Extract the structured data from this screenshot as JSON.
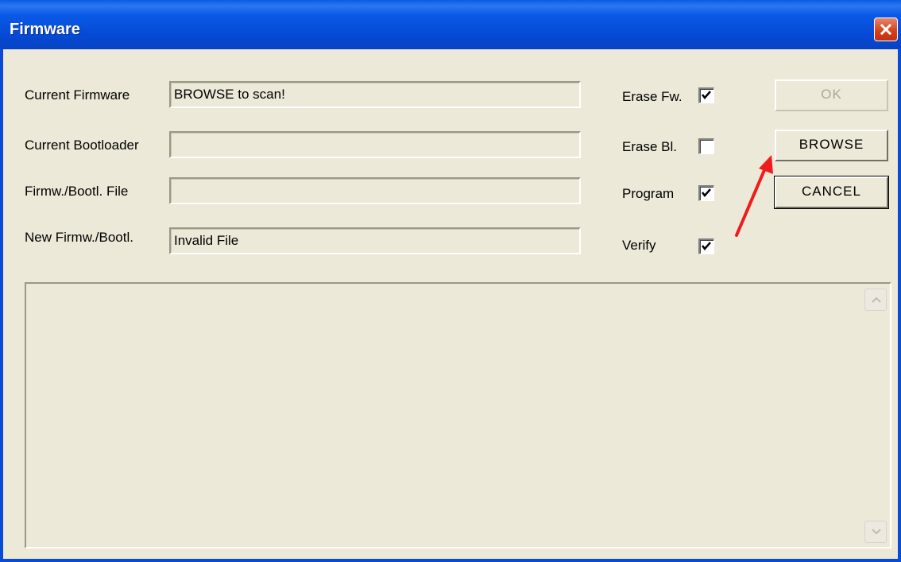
{
  "window": {
    "title": "Firmware"
  },
  "fields": [
    {
      "label": "Current Firmware",
      "value": "BROWSE to scan!"
    },
    {
      "label": "Current Bootloader",
      "value": ""
    },
    {
      "label": "Firmw./Bootl. File",
      "value": ""
    },
    {
      "label": "New Firmw./Bootl.",
      "value": "Invalid File"
    }
  ],
  "options": [
    {
      "label": "Erase Fw.",
      "checked": true
    },
    {
      "label": "Erase Bl.",
      "checked": false
    },
    {
      "label": "Program",
      "checked": true
    },
    {
      "label": "Verify",
      "checked": true
    }
  ],
  "buttons": {
    "ok": "OK",
    "browse": "BROWSE",
    "cancel": "CANCEL"
  },
  "log": {
    "content": ""
  },
  "colors": {
    "titlebar": "#0a5ae6",
    "annotation_arrow": "#ee1c1c",
    "close_button": "#d5431d"
  },
  "icons": {
    "close": "close-icon",
    "check": "checkmark-icon",
    "scroll_up": "scroll-up-icon",
    "scroll_down": "scroll-down-icon",
    "annotation": "red-arrow-icon"
  }
}
